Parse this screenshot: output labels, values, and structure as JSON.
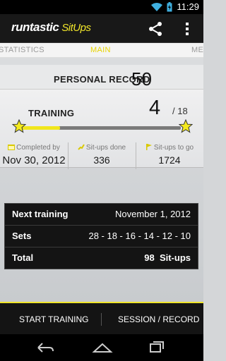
{
  "status_bar": {
    "time": "11:29",
    "icons": [
      "wifi-icon",
      "battery-icon"
    ]
  },
  "app_bar": {
    "logo_text": "runtastic",
    "logo_sub": "SitUps",
    "actions": [
      "share-icon",
      "overflow-menu-icon"
    ]
  },
  "tabs": {
    "left": "STATISTICS",
    "active": "MAIN",
    "right": "ME"
  },
  "personal_record": {
    "label": "PERSONAL RECORD",
    "value": "50"
  },
  "training": {
    "label": "TRAINING",
    "current": "4",
    "total": "/ 18",
    "progress_fraction": 0.25
  },
  "stats": {
    "completed": {
      "label": "Completed by",
      "value": "Nov 30, 2012"
    },
    "done": {
      "label": "Sit-ups done",
      "value": "336"
    },
    "to_go": {
      "label": "Sit-ups to go",
      "value": "1724"
    }
  },
  "next_training": {
    "header_label": "Next training",
    "date": "November 1, 2012",
    "sets_label": "Sets",
    "sets_value": "28 - 18 - 16 - 14 - 12 - 10",
    "total_label": "Total",
    "total_value": "98",
    "total_unit": "Sit-ups"
  },
  "bottom": {
    "start": "START TRAINING",
    "session": "SESSION / RECORD"
  },
  "colors": {
    "accent": "#f0e52a",
    "dark": "#141414"
  }
}
